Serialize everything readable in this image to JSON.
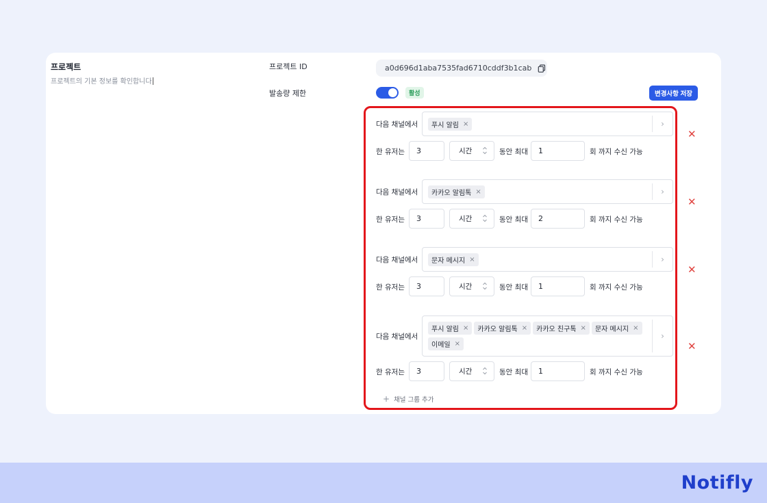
{
  "section": {
    "title": "프로젝트",
    "description": "프로젝트의 기본 정보를 확인합니다"
  },
  "project_id": {
    "label": "프로젝트 ID",
    "value": "a0d696d1aba7535fad6710cddf3b1cab",
    "copy_icon": "copy-icon"
  },
  "rate_limit": {
    "label": "발송량 제한",
    "toggle_on": true,
    "status_badge": "활성",
    "save_button": "변경사항 저장"
  },
  "colors": {
    "accent": "#2b5be6",
    "highlight_frame": "#e3161b",
    "delete": "#e0433f",
    "badge_bg": "#e1f5e8",
    "badge_text": "#2e9e5c"
  },
  "labels": {
    "channel_prefix": "다음 채널에서",
    "user_prefix": "한 유저는",
    "max_text": "동안 최대",
    "suffix": "회 까지 수신 가능"
  },
  "groups": [
    {
      "channels": [
        "푸시 알림"
      ],
      "period": "3",
      "unit": "시간",
      "max": "1"
    },
    {
      "channels": [
        "카카오 알림톡"
      ],
      "period": "3",
      "unit": "시간",
      "max": "2"
    },
    {
      "channels": [
        "문자 메시지"
      ],
      "period": "3",
      "unit": "시간",
      "max": "1"
    },
    {
      "channels": [
        "푸시 알림",
        "카카오 알림톡",
        "카카오 친구톡",
        "문자 메시지",
        "이메일"
      ],
      "period": "3",
      "unit": "시간",
      "max": "1"
    }
  ],
  "add_group": {
    "icon": "plus-icon",
    "label": "채널 그룹 추가"
  },
  "brand": "Notifly"
}
